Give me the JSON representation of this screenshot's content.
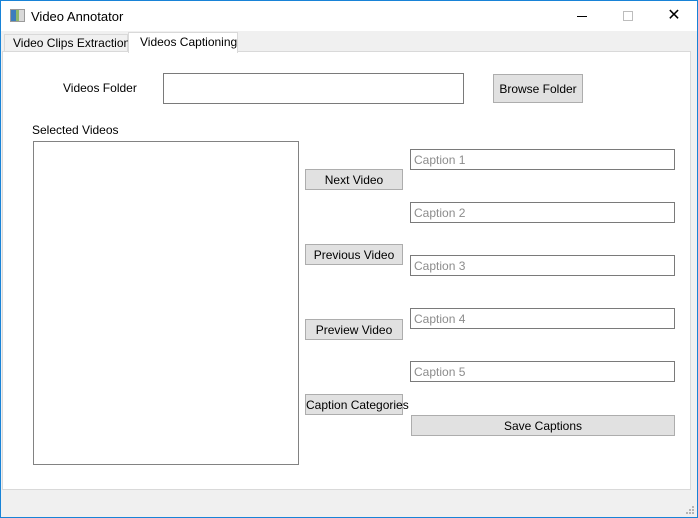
{
  "window": {
    "title": "Video Annotator",
    "icon": "app-icon",
    "controls": [
      "minimize",
      "maximize",
      "close"
    ],
    "close_glyph": "✕"
  },
  "tabs": [
    {
      "label": "Video Clips Extraction",
      "active": false
    },
    {
      "label": "Videos Captioning",
      "active": true
    }
  ],
  "captioning": {
    "folder_label": "Videos Folder",
    "folder_value": "",
    "browse_label": "Browse Folder",
    "selected_label": "Selected Videos",
    "selected_videos": [],
    "buttons": {
      "next": "Next Video",
      "previous": "Previous Video",
      "preview": "Preview Video",
      "categories": "Caption Categories",
      "save": "Save Captions"
    },
    "captions": [
      {
        "placeholder": "Caption 1",
        "value": ""
      },
      {
        "placeholder": "Caption 2",
        "value": ""
      },
      {
        "placeholder": "Caption 3",
        "value": ""
      },
      {
        "placeholder": "Caption 4",
        "value": ""
      },
      {
        "placeholder": "Caption 5",
        "value": ""
      }
    ]
  },
  "colors": {
    "accent_border": "#1883d7",
    "button_bg": "#e1e1e1",
    "placeholder": "#8c8c8c"
  }
}
